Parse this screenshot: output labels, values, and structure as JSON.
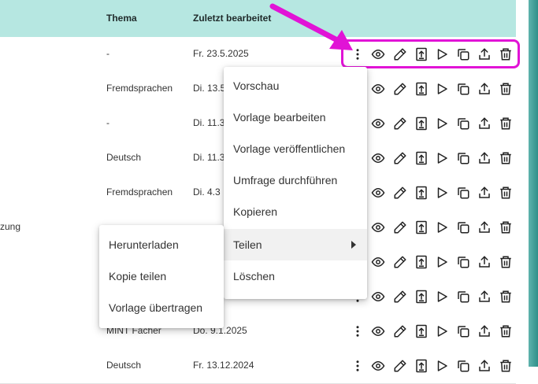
{
  "header": {
    "topic": "Thema",
    "last_edited": "Zuletzt bearbeitet"
  },
  "rows": [
    {
      "name": "",
      "topic": "-",
      "date": "Fr. 23.5.2025"
    },
    {
      "name": "",
      "topic": "Fremdsprachen",
      "date": "Di. 13.5"
    },
    {
      "name": "",
      "topic": "-",
      "date": "Di. 11.3"
    },
    {
      "name": "",
      "topic": "Deutsch",
      "date": "Di. 11.3"
    },
    {
      "name": "",
      "topic": "Fremdsprachen",
      "date": "Di. 4.3"
    },
    {
      "name": "zung",
      "topic": "",
      "date": ""
    },
    {
      "name": "",
      "topic": "",
      "date": ""
    },
    {
      "name": "",
      "topic": "",
      "date": ""
    },
    {
      "name": "",
      "topic": "MINT Fächer",
      "date": "Do. 9.1.2025"
    },
    {
      "name": "",
      "topic": "Deutsch",
      "date": "Fr. 13.12.2024"
    }
  ],
  "action_icons": [
    "more-vertical-icon",
    "eye-icon",
    "pencil-icon",
    "publish-icon",
    "play-icon",
    "copy-icon",
    "share-icon",
    "trash-icon"
  ],
  "context_menu": {
    "items": [
      "Vorschau",
      "Vorlage bearbeiten",
      "Vorlage veröffentlichen",
      "Umfrage durchführen",
      "Kopieren",
      "Teilen",
      "Löschen"
    ],
    "active_index": 5
  },
  "submenu": {
    "items": [
      "Herunterladen",
      "Kopie teilen",
      "Vorlage übertragen"
    ]
  },
  "colors": {
    "header_bg": "#b6e7e1",
    "highlight": "#e113d6",
    "arrow": "#e113d6",
    "scrollbar": "#2f8f89"
  }
}
